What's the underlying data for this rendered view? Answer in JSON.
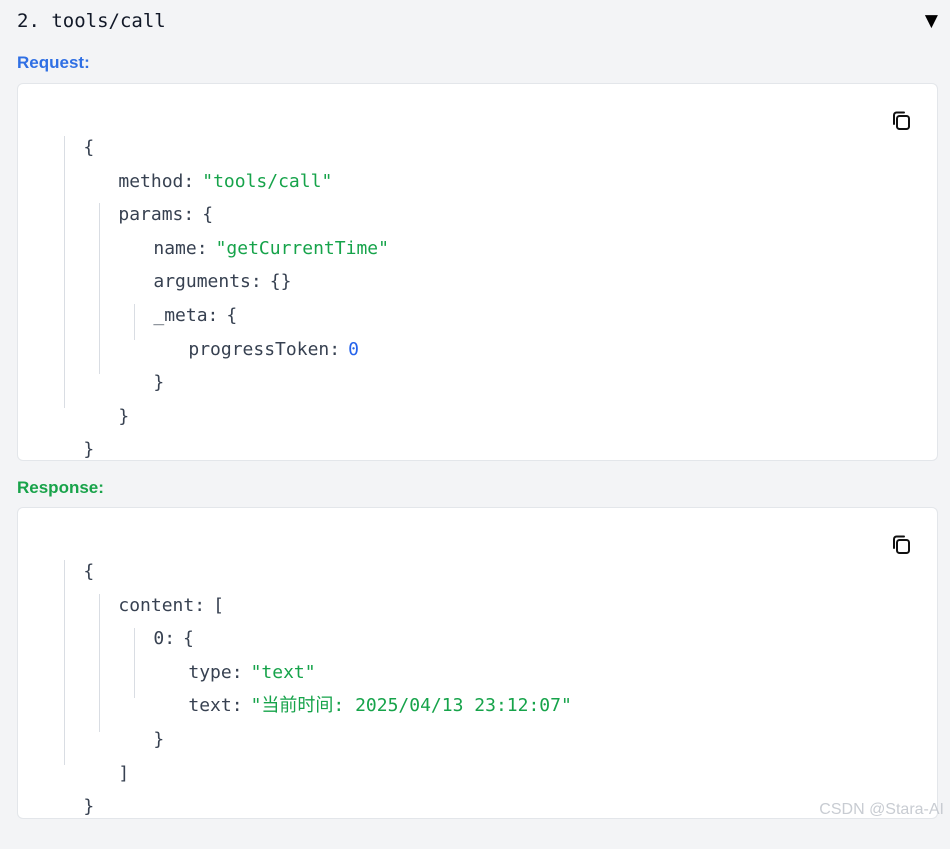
{
  "header": {
    "title": "2. tools/call",
    "toggle_icon": "▼"
  },
  "request": {
    "label": "Request:",
    "open_brace": "{",
    "method_key": "method",
    "method_value": "\"tools/call\"",
    "params_key": "params",
    "params_open": "{",
    "name_key": "name",
    "name_value": "\"getCurrentTime\"",
    "arguments_key": "arguments",
    "arguments_value": "{}",
    "meta_key": "_meta",
    "meta_open": "{",
    "progress_key": "progressToken",
    "progress_value": "0",
    "meta_close": "}",
    "params_close": "}",
    "close_brace": "}"
  },
  "response": {
    "label": "Response:",
    "open_brace": "{",
    "content_key": "content",
    "content_open": "[",
    "item_key": "0",
    "item_open": "{",
    "type_key": "type",
    "type_value": "\"text\"",
    "text_key": "text",
    "text_value": "\"当前时间: 2025/04/13 23:12:07\"",
    "item_close": "}",
    "content_close": "]",
    "close_brace": "}"
  },
  "watermark": "CSDN @Stara-AI"
}
